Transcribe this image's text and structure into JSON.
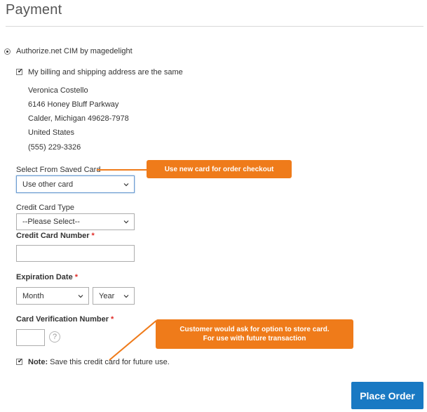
{
  "page": {
    "title": "Payment"
  },
  "payment_method": {
    "label": "Authorize.net CIM by magedelight",
    "selected": true
  },
  "billing": {
    "same_as_shipping_label": "My billing and shipping address are the same",
    "same_as_shipping_checked": true,
    "address": {
      "name": "Veronica Costello",
      "street": "6146 Honey Bluff Parkway",
      "city_line": "Calder, Michigan 49628-7978",
      "country": "United States",
      "phone": "(555) 229-3326"
    }
  },
  "saved_card": {
    "label": "Select From Saved Card",
    "value": "Use other card"
  },
  "card_type": {
    "label": "Credit Card Type",
    "value": "--Please Select--"
  },
  "card_number": {
    "label": "Credit Card Number",
    "required_mark": "*",
    "value": ""
  },
  "expiration": {
    "label": "Expiration Date",
    "required_mark": "*",
    "month": "Month",
    "year": "Year"
  },
  "cvv": {
    "label": "Card Verification Number",
    "required_mark": "*",
    "value": "",
    "help_glyph": "?"
  },
  "save_card": {
    "note_prefix": "Note:",
    "text": " Save this credit card for future use.",
    "checked": true
  },
  "callouts": {
    "saved_card": "Use new card for order checkout",
    "store_card_line1": "Customer would ask for option to store card.",
    "store_card_line2": "For use with future transaction"
  },
  "actions": {
    "place_order": "Place Order"
  },
  "colors": {
    "primary_button": "#1979c3",
    "callout": "#ef7b1a",
    "required": "#e02b27",
    "focus_border": "#6a9bd1"
  },
  "icons": [
    "chevron-down-icon",
    "question-mark-icon",
    "checkbox-check-icon",
    "radio-dot-icon"
  ]
}
